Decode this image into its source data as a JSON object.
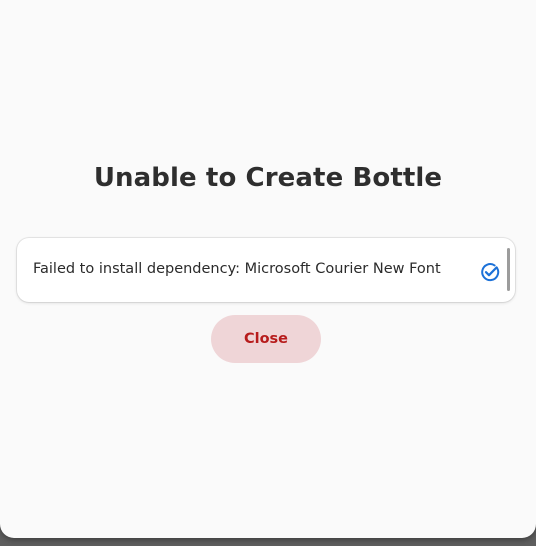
{
  "dialog": {
    "title": "Unable to Create Bottle",
    "message": "Failed to install dependency: Microsoft Courier New Font",
    "message_icon": "check-circle-icon",
    "close_label": "Close"
  },
  "colors": {
    "dialog_background": "#fafafa",
    "accent_blue": "#1c71d8",
    "destructive_text": "#b71c1c",
    "destructive_background": "#efd5d7"
  }
}
